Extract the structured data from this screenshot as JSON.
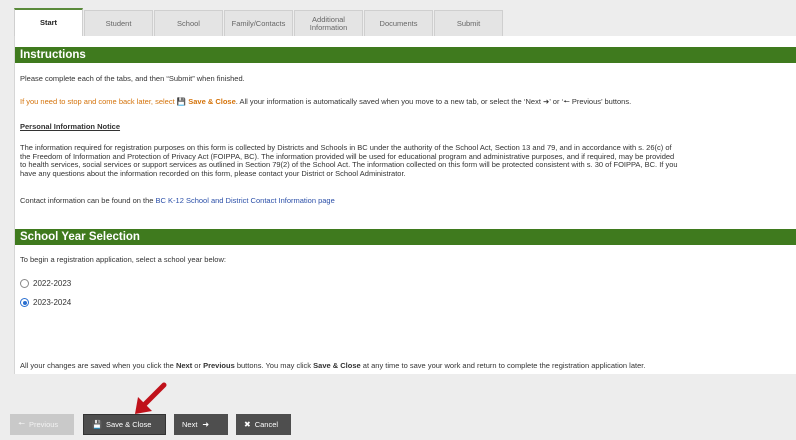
{
  "tabs": [
    {
      "label": "Start",
      "active": true
    },
    {
      "label": "Student"
    },
    {
      "label": "School"
    },
    {
      "label": "Family/Contacts"
    },
    {
      "label": "Additional Information"
    },
    {
      "label": "Documents"
    },
    {
      "label": "Submit"
    }
  ],
  "instructions": {
    "header": "Instructions",
    "line1": "Please complete each of the tabs, and then “Submit” when finished.",
    "line2_pre": "If you need to stop and come back later, select",
    "line2_save": "Save & Close",
    "line2_post": ". All your information is automatically saved when you move to a new tab, or select the ‘Next",
    "line2_or": "’ or ‘",
    "line2_end": "Previous’ buttons.",
    "notice_title": "Personal Information Notice",
    "notice_lines": [
      "The information required for registration purposes on this form is collected by Districts and Schools in BC under the authority of the School Act, Section 13 and 79, and in accordance with s. 26(c) of",
      "the Freedom of Information and Protection of Privacy Act (FOIPPA, BC). The information provided will be used for educational program and administrative purposes, and if required, may be provided",
      "to health services, social services or support services as outlined in Section 79(2) of the School Act. The information collected on this form will be protected consistent with s. 30 of FOIPPA, BC. If you",
      "have any questions about the information recorded on this form, please contact your District or School Administrator."
    ],
    "contact_pre": "Contact information can be found on the",
    "contact_link": "BC K-12 School and District Contact Information page"
  },
  "school_year": {
    "header": "School Year Selection",
    "prompt": "To begin a registration application, select a school year below:",
    "options": [
      {
        "label": "2022-2023",
        "checked": false
      },
      {
        "label": "2023-2024",
        "checked": true
      }
    ]
  },
  "footer_note": {
    "pre": "All your changes are saved when you click the",
    "next": "Next",
    "or": "or",
    "previous": "Previous",
    "mid": "buttons. You may click",
    "save": "Save & Close",
    "post": "at any time to save your work and return to complete the registration application later."
  },
  "buttons": {
    "previous": "Previous",
    "save_close": "Save & Close",
    "next": "Next",
    "cancel": "Cancel"
  },
  "colors": {
    "header_green": "#3f7a1e",
    "accent_orange": "#d4730b",
    "link_blue": "#2b4fa8",
    "arrow_red": "#c0121b"
  }
}
